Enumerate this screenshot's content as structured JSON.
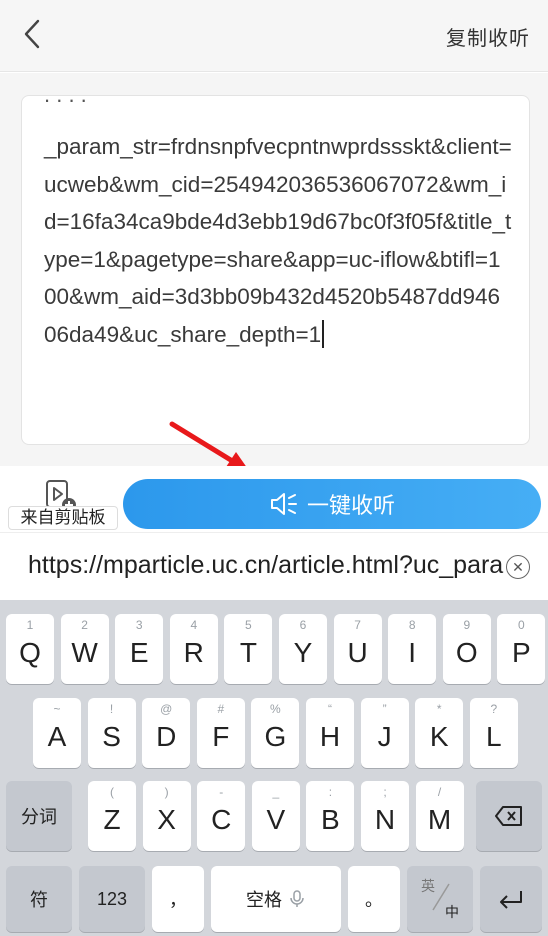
{
  "header": {
    "copy_listen": "复制收听"
  },
  "text_area": {
    "cut_line": ".  .  .  .",
    "content": "_param_str=frdnsnpfvecpntnwprdssskt&client=ucweb&wm_cid=254942036536067072&wm_id=16fa34ca9bde4d3ebb19d67bc0f3f05f&title_type=1&pagetype=share&app=uc-iflow&btifl=100&wm_aid=3d3bb09b432d4520b5487dd94606da49&uc_share_depth=1"
  },
  "actions": {
    "clipboard_label": "来自剪贴板",
    "listen_label": "一键收听"
  },
  "url_suggestion": {
    "text": "https://mparticle.uc.cn/article.html?uc_param_str"
  },
  "keyboard": {
    "row1": [
      {
        "key": "Q",
        "hint": "1"
      },
      {
        "key": "W",
        "hint": "2"
      },
      {
        "key": "E",
        "hint": "3"
      },
      {
        "key": "R",
        "hint": "4"
      },
      {
        "key": "T",
        "hint": "5"
      },
      {
        "key": "Y",
        "hint": "6"
      },
      {
        "key": "U",
        "hint": "7"
      },
      {
        "key": "I",
        "hint": "8"
      },
      {
        "key": "O",
        "hint": "9"
      },
      {
        "key": "P",
        "hint": "0"
      }
    ],
    "row2": [
      {
        "key": "A",
        "hint": "~"
      },
      {
        "key": "S",
        "hint": "!"
      },
      {
        "key": "D",
        "hint": "@"
      },
      {
        "key": "F",
        "hint": "#"
      },
      {
        "key": "G",
        "hint": "%"
      },
      {
        "key": "H",
        "hint": "“"
      },
      {
        "key": "J",
        "hint": "”"
      },
      {
        "key": "K",
        "hint": "*"
      },
      {
        "key": "L",
        "hint": "?"
      }
    ],
    "row3": [
      {
        "key": "Z",
        "hint": "("
      },
      {
        "key": "X",
        "hint": ")"
      },
      {
        "key": "C",
        "hint": "-"
      },
      {
        "key": "V",
        "hint": "_"
      },
      {
        "key": "B",
        "hint": ":"
      },
      {
        "key": "N",
        "hint": ";"
      },
      {
        "key": "M",
        "hint": "/"
      }
    ],
    "segment_label": "分词",
    "symbol_label": "符",
    "num_label": "123",
    "comma_label": "，",
    "space_label": "空格",
    "period_label": "。",
    "ime_top": "英",
    "ime_bottom": "中"
  }
}
